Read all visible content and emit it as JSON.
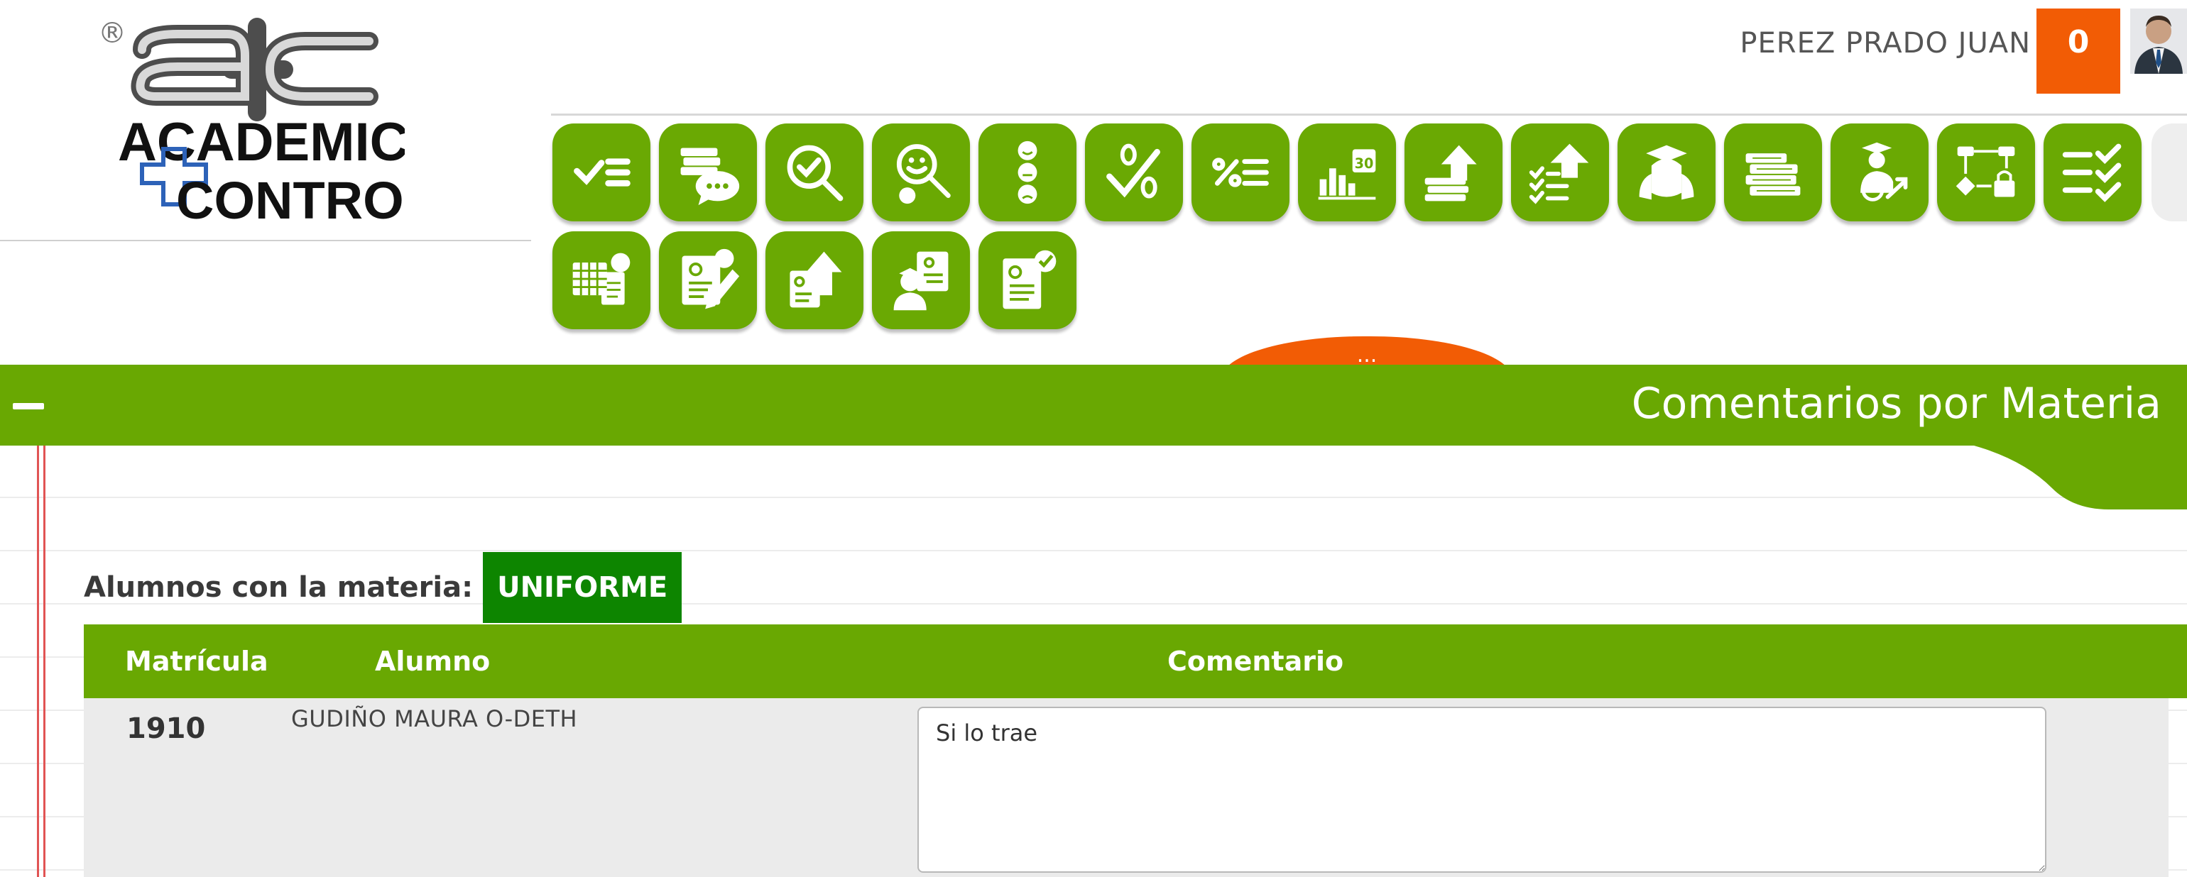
{
  "header": {
    "logo": {
      "registered_mark": "®",
      "line1": "ACADEMIC",
      "line2": "CONTROL"
    },
    "user_name": "PEREZ PRADO JUAN",
    "notification_count": "0"
  },
  "toolbar": {
    "row1_icons": [
      "checklist-icon",
      "courses-comments-icon",
      "search-check-icon",
      "search-face-icon",
      "faces-icon",
      "check-zero-icon",
      "percent-list-icon",
      "calendar-chart-icon",
      "upload-books-icon",
      "list-upload-icon",
      "student-cap-icon",
      "books-stack-icon",
      "graduate-clock-icon",
      "flow-lock-icon",
      "triple-check-icon"
    ],
    "row2_icons": [
      "calendar-grid-icon",
      "document-edit-icon",
      "document-upload-icon",
      "student-document-icon",
      "document-approve-icon"
    ]
  },
  "expand_tab": {
    "label": "..."
  },
  "title_bar": {
    "title": "Comentarios por Materia"
  },
  "subject": {
    "label": "Alumnos con la materia:",
    "name": "UNIFORME"
  },
  "table": {
    "columns": [
      "Matrícula",
      "Alumno",
      "Comentario"
    ],
    "rows": [
      {
        "matricula": "1910",
        "alumno": "GUDIÑO MAURA O-DETH",
        "comentario": "Si lo trae"
      }
    ]
  },
  "colors": {
    "accent_green": "#69a802",
    "badge_green": "#0d8500",
    "accent_orange": "#f25c05",
    "margin_red": "#e15454"
  }
}
